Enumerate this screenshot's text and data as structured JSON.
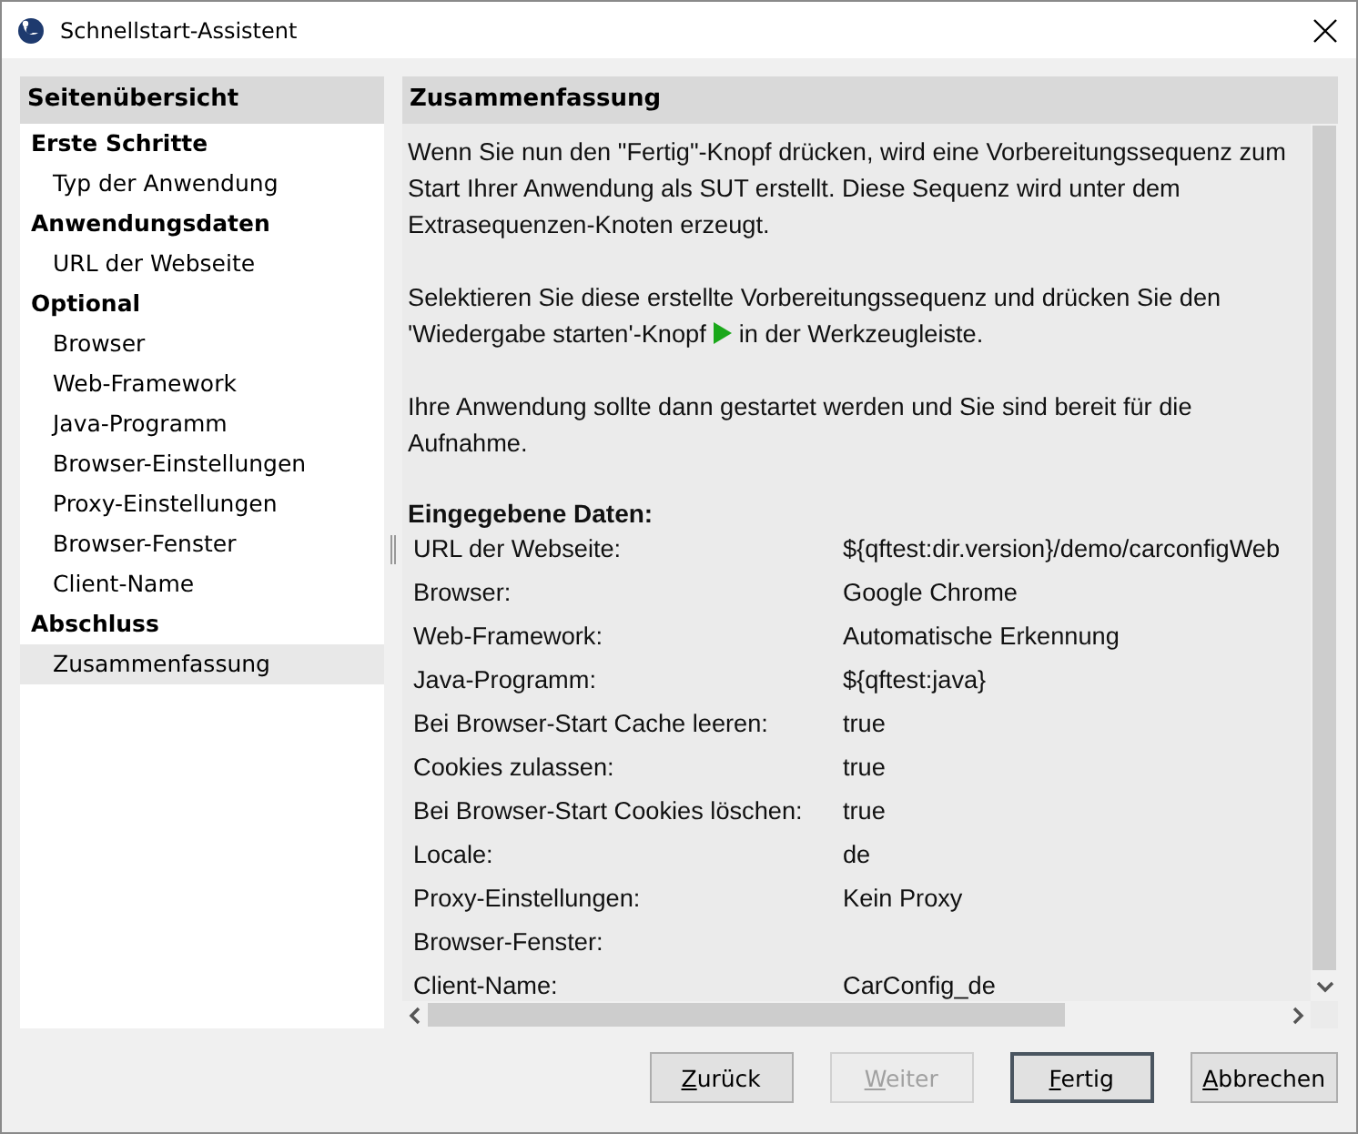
{
  "window": {
    "title": "Schnellstart-Assistent"
  },
  "sidebar": {
    "title": "Seitenübersicht",
    "groups": [
      {
        "label": "Erste Schritte",
        "items": [
          {
            "label": "Typ der Anwendung",
            "selected": false
          }
        ]
      },
      {
        "label": "Anwendungsdaten",
        "items": [
          {
            "label": "URL der Webseite",
            "selected": false
          }
        ]
      },
      {
        "label": "Optional",
        "items": [
          {
            "label": "Browser",
            "selected": false
          },
          {
            "label": "Web-Framework",
            "selected": false
          },
          {
            "label": "Java-Programm",
            "selected": false
          },
          {
            "label": "Browser-Einstellungen",
            "selected": false
          },
          {
            "label": "Proxy-Einstellungen",
            "selected": false
          },
          {
            "label": "Browser-Fenster",
            "selected": false
          },
          {
            "label": "Client-Name",
            "selected": false
          }
        ]
      },
      {
        "label": "Abschluss",
        "items": [
          {
            "label": "Zusammenfassung",
            "selected": true
          }
        ]
      }
    ]
  },
  "content": {
    "title": "Zusammenfassung",
    "paragraph_1": "Wenn Sie nun den \"Fertig\"-Knopf drücken, wird eine Vorbereitungssequenz zum Start Ihrer Anwendung als SUT erstellt. Diese Sequenz wird unter dem Extrasequenzen-Knoten erzeugt.",
    "paragraph_2_line_1": "Selektieren Sie diese erstellte Vorbereitungssequenz und drücken Sie den",
    "paragraph_2_before_icon": "'Wiedergabe starten'-Knopf",
    "paragraph_2_after_icon": "in der Werkzeugleiste.",
    "paragraph_3": "Ihre Anwendung sollte dann gestartet werden und Sie sind bereit für die Aufnahme.",
    "data_heading": "Eingegebene Daten:",
    "rows": [
      {
        "label": "URL der Webseite:",
        "value": "${qftest:dir.version}/demo/carconfigWeb"
      },
      {
        "label": "Browser:",
        "value": "Google Chrome"
      },
      {
        "label": "Web-Framework:",
        "value": "Automatische Erkennung"
      },
      {
        "label": "Java-Programm:",
        "value": "${qftest:java}"
      },
      {
        "label": "Bei Browser-Start Cache leeren:",
        "value": "true"
      },
      {
        "label": "Cookies zulassen:",
        "value": "true"
      },
      {
        "label": "Bei Browser-Start Cookies löschen:",
        "value": "true"
      },
      {
        "label": "Locale:",
        "value": "de"
      },
      {
        "label": "Proxy-Einstellungen:",
        "value": "Kein Proxy"
      },
      {
        "label": "Browser-Fenster:"
      },
      {
        "label": "Client-Name:",
        "value": "CarConfig_de"
      }
    ]
  },
  "buttons": [
    {
      "label": "Zurück",
      "disabled": false,
      "default": false
    },
    {
      "label": "Weiter",
      "disabled": true,
      "default": false
    },
    {
      "label": "Fertig",
      "disabled": false,
      "default": true
    },
    {
      "label": "Abbrechen",
      "disabled": false,
      "default": false
    }
  ]
}
